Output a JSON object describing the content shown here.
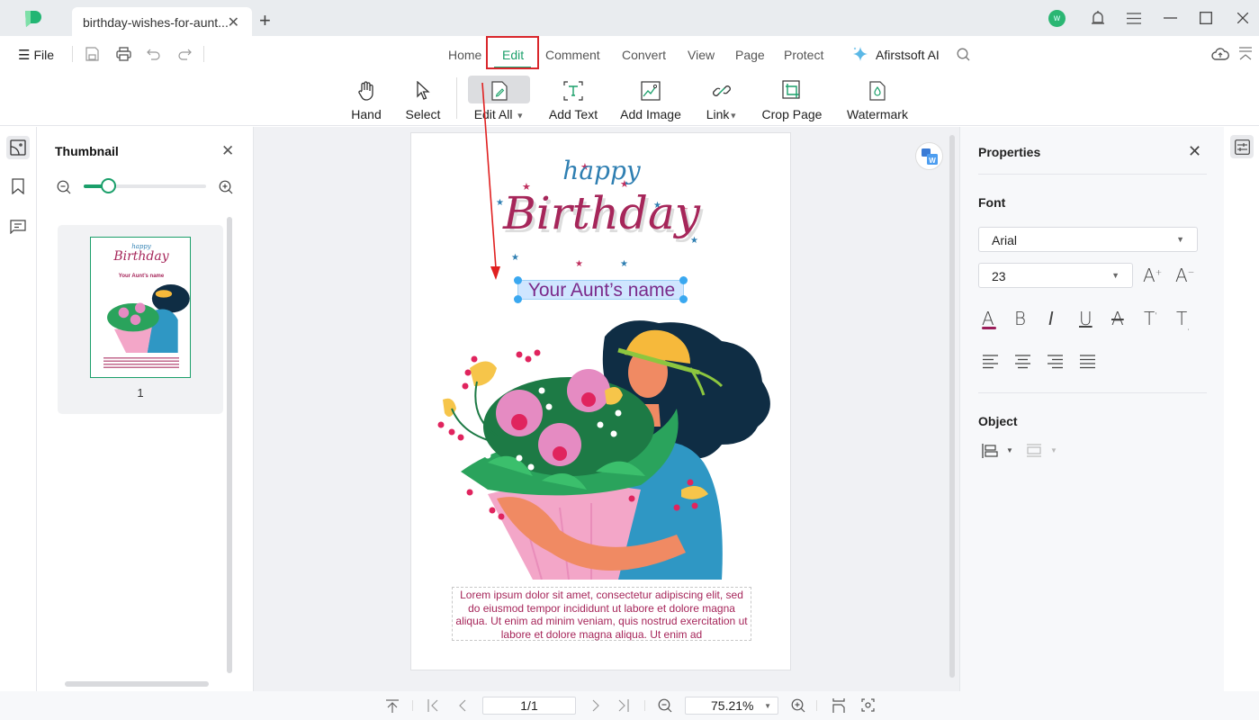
{
  "app": {
    "tab_title": "birthday-wishes-for-aunt...",
    "avatar_initial": "w"
  },
  "menu": {
    "file_label": "File",
    "tabs": [
      {
        "label": "Home"
      },
      {
        "label": "Edit",
        "active": true
      },
      {
        "label": "Comment"
      },
      {
        "label": "Convert"
      },
      {
        "label": "View"
      },
      {
        "label": "Page"
      },
      {
        "label": "Protect"
      }
    ],
    "ai_label": "Afirstsoft AI"
  },
  "toolbar": {
    "tools": [
      {
        "label": "Hand",
        "icon": "hand-icon"
      },
      {
        "label": "Select",
        "icon": "cursor-icon"
      },
      {
        "label": "Edit All",
        "icon": "edit-all-icon",
        "dropdown": true,
        "active": true
      },
      {
        "label": "Add Text",
        "icon": "add-text-icon"
      },
      {
        "label": "Add Image",
        "icon": "add-image-icon"
      },
      {
        "label": "Link",
        "icon": "link-icon",
        "dropdown": true
      },
      {
        "label": "Crop Page",
        "icon": "crop-icon"
      },
      {
        "label": "Watermark",
        "icon": "watermark-icon"
      }
    ]
  },
  "thumbnail_panel": {
    "title": "Thumbnail",
    "zoom_fraction": 0.2,
    "pages": [
      {
        "number": "1"
      }
    ]
  },
  "document": {
    "happy": "happy",
    "birthday": "Birthday",
    "name_text": "Your Aunt’s name",
    "lorem": "Lorem ipsum dolor sit amet, consectetur adipiscing elit, sed do eiusmod tempor incididunt ut labore et dolore magna aliqua. Ut enim ad minim veniam, quis nostrud exercitation ut labore et dolore magna aliqua. Ut enim ad",
    "thumb_name": "Your Aunt’s name"
  },
  "properties": {
    "title": "Properties",
    "font_section": "Font",
    "font_family": "Arial",
    "font_size": "23",
    "object_section": "Object",
    "text_color": "#9b1e5a"
  },
  "statusbar": {
    "page_field": "1/1",
    "zoom_value": "75.21%"
  },
  "colors": {
    "accent": "#1a9f6a",
    "highlight_box": "#d9262b"
  }
}
